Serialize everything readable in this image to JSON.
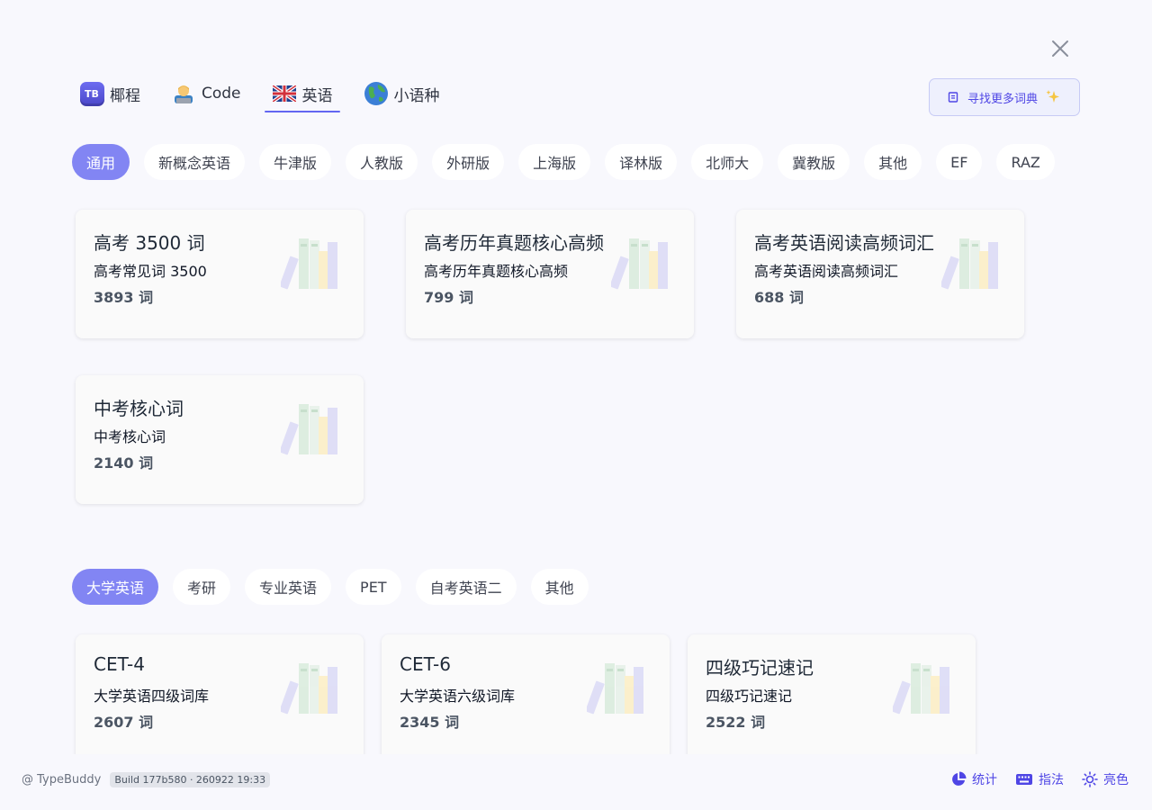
{
  "top_tabs": [
    {
      "label": "椰程",
      "icon": "tb-logo-icon",
      "logo_text": "TB"
    },
    {
      "label": "Code",
      "icon": "technologist-emoji-icon"
    },
    {
      "label": "英语",
      "icon": "uk-flag-icon"
    },
    {
      "label": "小语种",
      "icon": "globe-icon"
    }
  ],
  "active_top_tab": "英语",
  "find_more_label": "寻找更多词典",
  "section1": {
    "chips": [
      "通用",
      "新概念英语",
      "牛津版",
      "人教版",
      "外研版",
      "上海版",
      "译林版",
      "北师大",
      "冀教版",
      "其他",
      "EF",
      "RAZ"
    ],
    "active": "通用",
    "cards": [
      {
        "title": "高考 3500 词",
        "subtitle": "高考常见词 3500",
        "count": "3893 词"
      },
      {
        "title": "高考历年真题核心高频",
        "subtitle": "高考历年真题核心高频",
        "count": "799 词"
      },
      {
        "title": "高考英语阅读高频词汇",
        "subtitle": "高考英语阅读高频词汇",
        "count": "688 词"
      },
      {
        "title": "中考核心词",
        "subtitle": "中考核心词",
        "count": "2140 词"
      }
    ]
  },
  "section2": {
    "chips": [
      "大学英语",
      "考研",
      "专业英语",
      "PET",
      "自考英语二",
      "其他"
    ],
    "active": "大学英语",
    "cards": [
      {
        "title": "CET-4",
        "subtitle": "大学英语四级词库",
        "count": "2607 词"
      },
      {
        "title": "CET-6",
        "subtitle": "大学英语六级词库",
        "count": "2345 词"
      },
      {
        "title": "四级巧记速记",
        "subtitle": "四级巧记速记",
        "count": "2522 词"
      }
    ]
  },
  "footer": {
    "brand": "@ TypeBuddy",
    "build": "Build 177b580 · 260922 19:33",
    "stats_label": "统计",
    "guide_label": "指法",
    "theme_label": "亮色"
  },
  "colors": {
    "accent": "#6366f1",
    "chip_active": "#8285f3",
    "background": "#f8f8fd"
  }
}
